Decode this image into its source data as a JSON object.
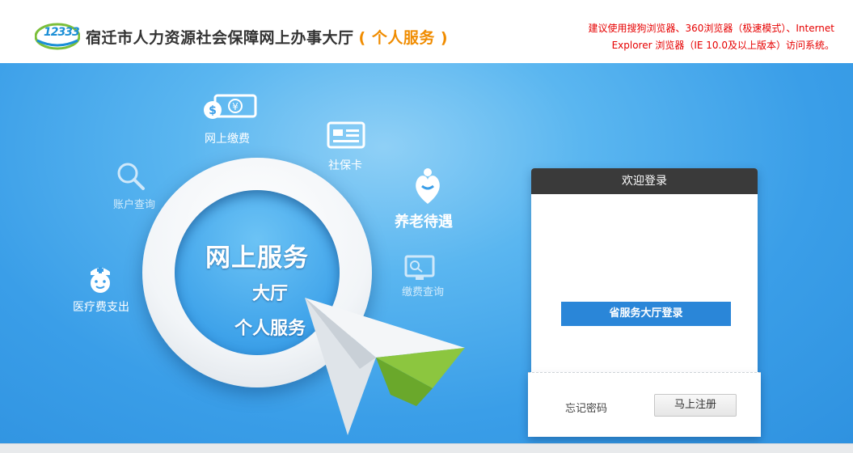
{
  "header": {
    "logo_text": "12333",
    "title": "宿迁市人力资源社会保障网上办事大厅",
    "subtitle": "( 个人服务 )",
    "notice_line1": "建议使用搜狗浏览器、360浏览器（极速模式）、Internet",
    "notice_line2": "Explorer 浏览器（IE 10.0及以上版本）访问系统。"
  },
  "services": {
    "online_payment": "网上缴费",
    "social_card": "社保卡",
    "account_query": "账户查询",
    "pension": "养老待遇",
    "payment_query": "缴费查询",
    "medical": "医疗费支出"
  },
  "hub": {
    "line1": "网上服务",
    "line2": "大厅",
    "line3": "个人服务"
  },
  "login": {
    "title": "欢迎登录",
    "provincial_login": "省服务大厅登录",
    "forgot_password": "忘记密码",
    "register": "马上注册"
  },
  "colors": {
    "accent_blue": "#2a86d8",
    "notice_red": "#e60000",
    "subtitle_orange": "#f08c00",
    "banner_blue": "#3a9ee8"
  }
}
